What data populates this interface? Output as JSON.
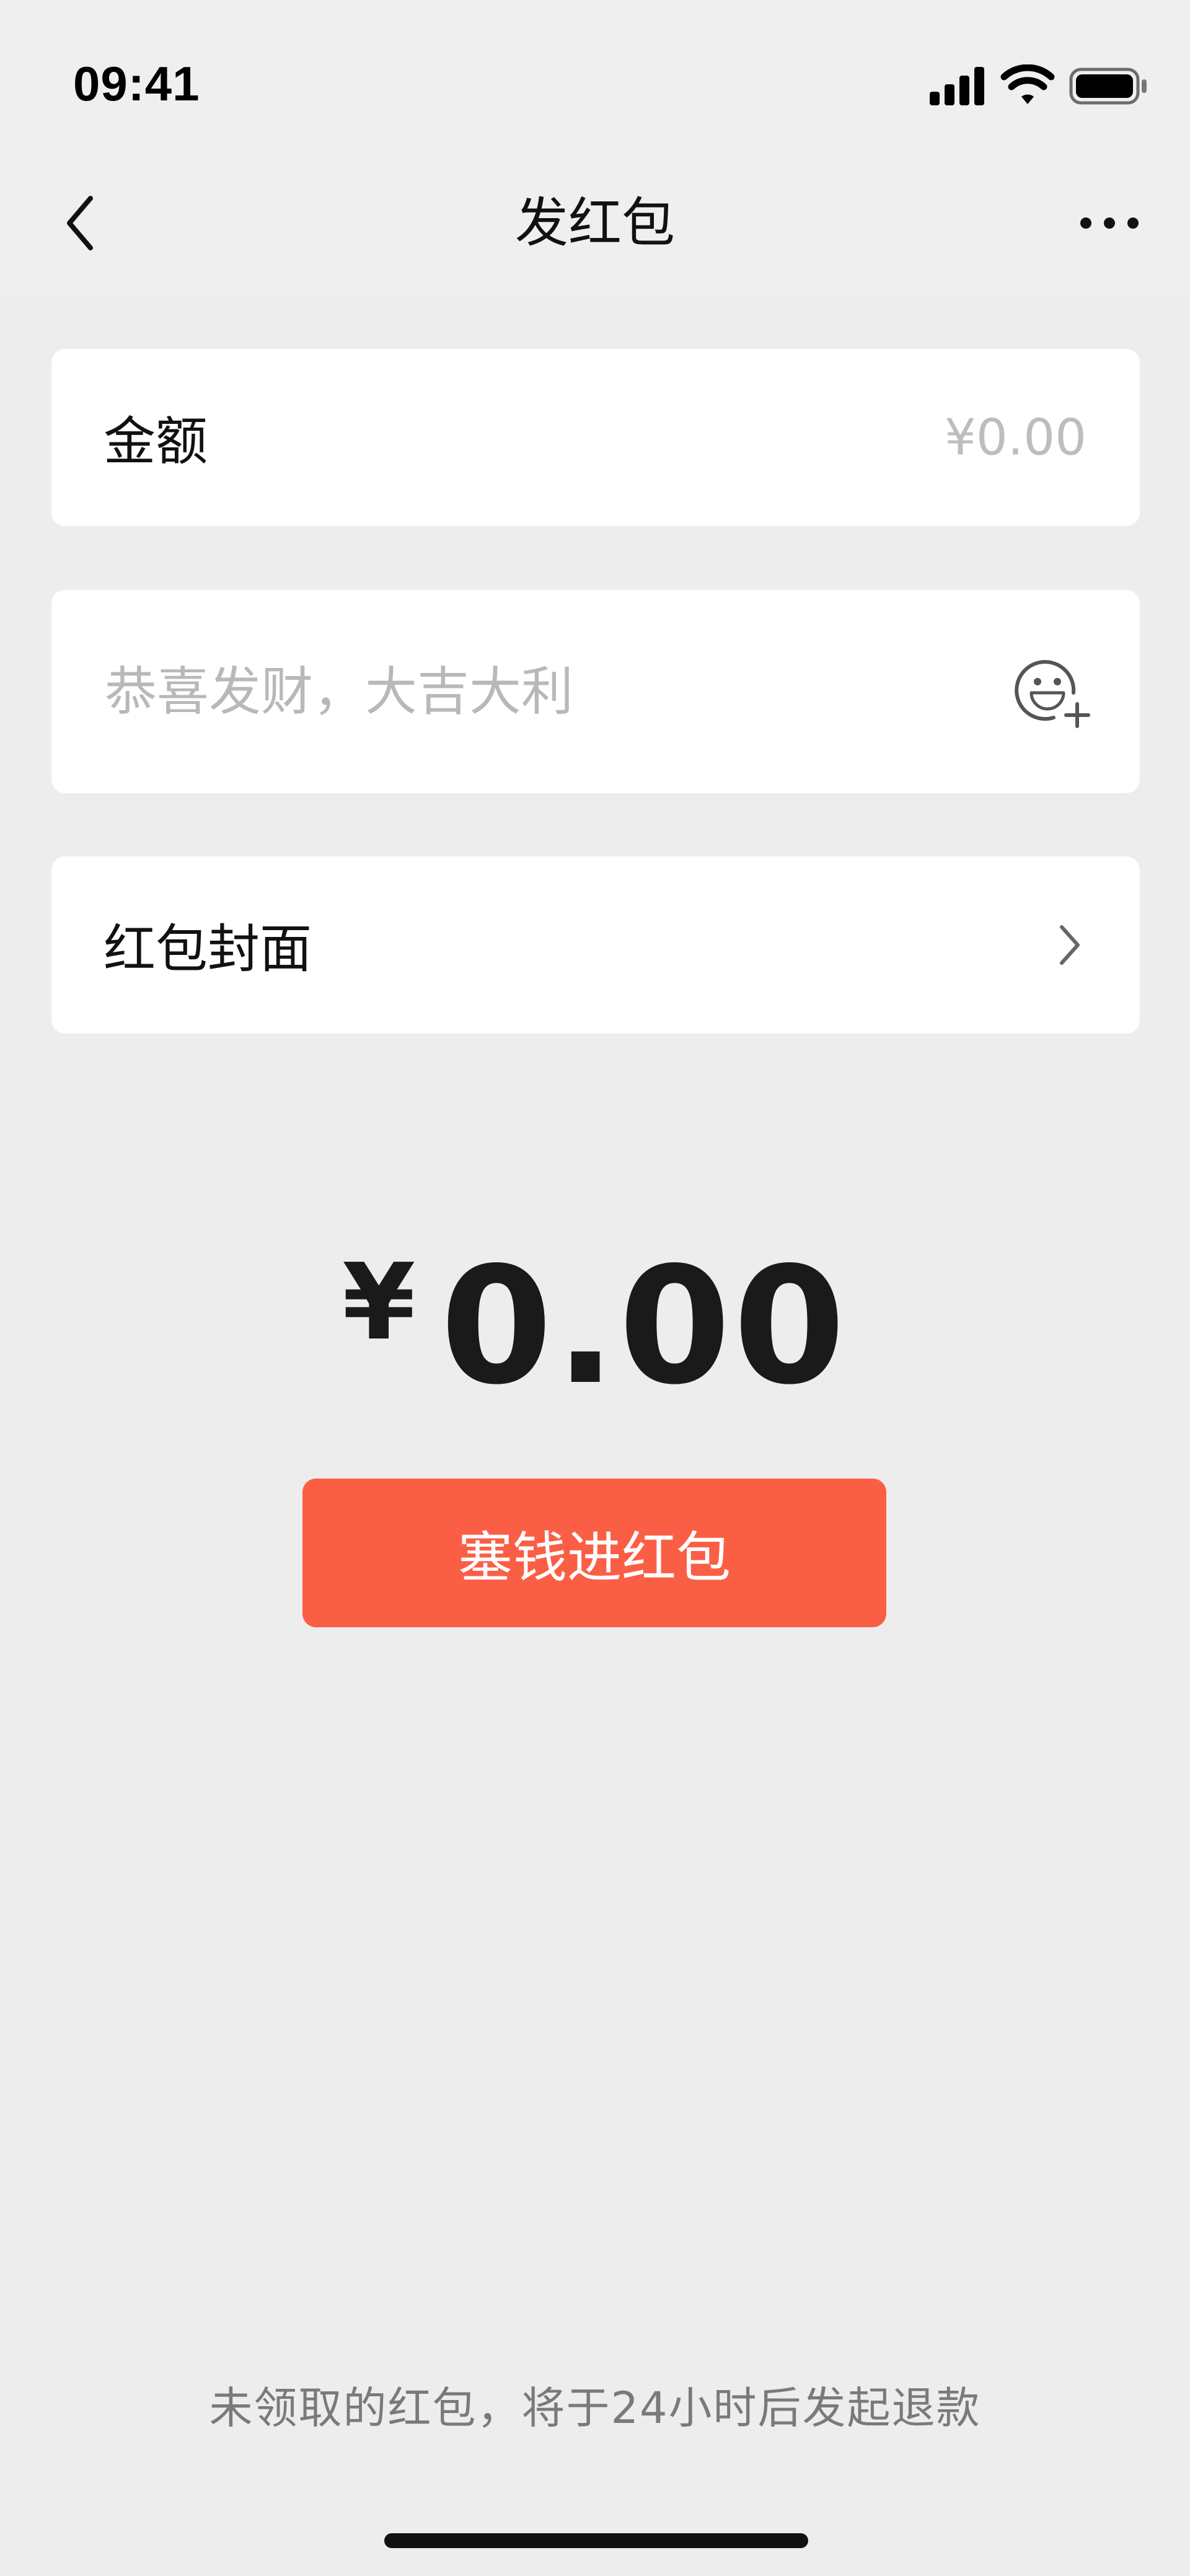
{
  "status_bar": {
    "time": "09:41",
    "icons": [
      "cellular-signal-icon",
      "wifi-icon",
      "battery-icon"
    ]
  },
  "nav": {
    "title": "发红包",
    "back_icon": "chevron-left-icon",
    "more_icon": "more-horizontal-icon"
  },
  "form": {
    "amount": {
      "label": "金额",
      "value": "",
      "placeholder": "¥0.00"
    },
    "greeting": {
      "value": "",
      "placeholder": "恭喜发财，大吉大利",
      "icon": "emoji-add-icon"
    },
    "cover": {
      "label": "红包封面",
      "icon": "chevron-right-icon"
    }
  },
  "total": {
    "currency": "¥",
    "value": "0.00"
  },
  "submit": {
    "label": "塞钱进红包"
  },
  "footer": {
    "note": "未领取的红包，将于24小时后发起退款"
  },
  "colors": {
    "background": "#EDEDED",
    "card": "#FFFFFF",
    "primary_button": "#FA5F46",
    "placeholder_text": "#BDBDBD",
    "footer_text": "#7A7A7A"
  }
}
